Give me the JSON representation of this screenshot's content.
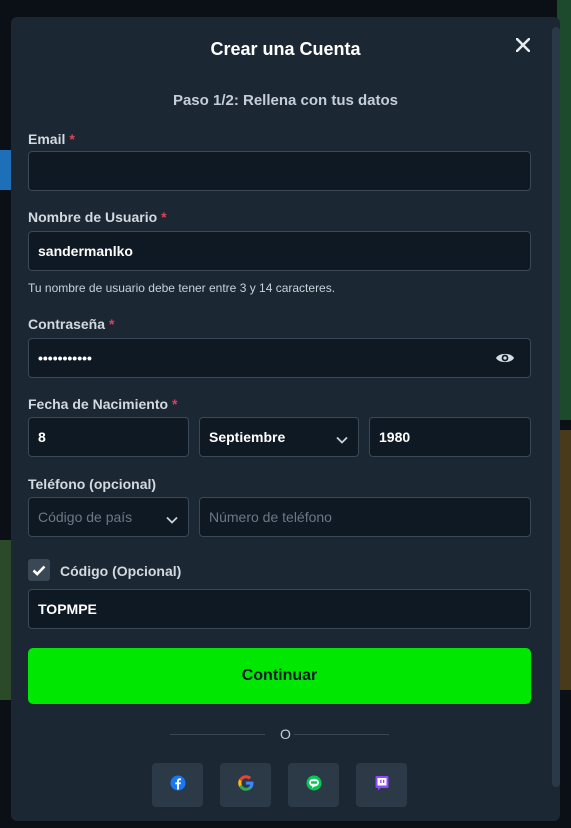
{
  "modal": {
    "title": "Crear una Cuenta",
    "step": "Paso 1/2: Rellena con tus datos"
  },
  "email": {
    "label": "Email",
    "required_mark": "*",
    "value": ""
  },
  "username": {
    "label": "Nombre de Usuario",
    "required_mark": "*",
    "value": "sandermanlko",
    "hint": "Tu nombre de usuario debe tener entre 3 y 14 caracteres."
  },
  "password": {
    "label": "Contraseña",
    "required_mark": "*",
    "value": "•••••••••••",
    "toggle_icon": "eye-icon"
  },
  "birthdate": {
    "label": "Fecha de Nacimiento",
    "required_mark": "*",
    "day": "8",
    "month": "Septiembre",
    "year": "1980"
  },
  "phone": {
    "label": "Teléfono (opcional)",
    "country_placeholder": "Código de país",
    "number_placeholder": "Número de teléfono"
  },
  "code": {
    "label": "Código (Opcional)",
    "checked": true,
    "value": "TOPMPE"
  },
  "actions": {
    "continue_label": "Continuar",
    "or_label": "O"
  },
  "social": [
    "facebook-icon",
    "google-icon",
    "line-icon",
    "twitch-icon"
  ],
  "colors": {
    "modal_bg": "#1b2733",
    "input_bg": "#0f1923",
    "accent_green": "#00e701",
    "required_red": "#e0405a"
  }
}
